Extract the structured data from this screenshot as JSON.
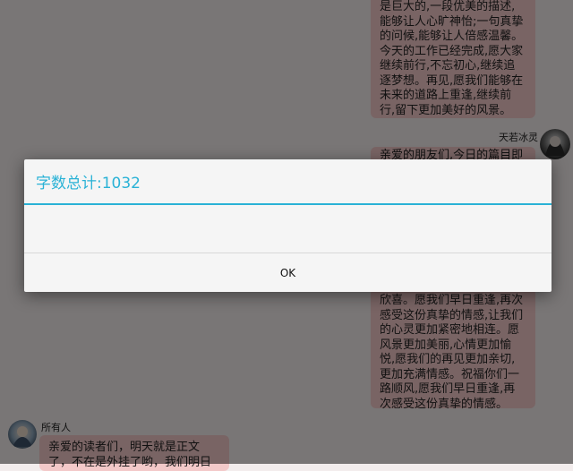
{
  "chat": {
    "top_message": "是巨大的,一段优美的描述,能够让人心旷神怡;一句真挚的问候,能够让人倍感温馨。今天的工作已经完成,愿大家继续前行,不忘初心,继续追逐梦想。再见,愿我们能够在未来的道路上重逢,继续前行,留下更加美好的风景。",
    "sender_right_name": "天若冰灵",
    "middle_partial": "亲爱的朋友们,今日的篇目即",
    "middle_message": "欣喜。愿我们早日重逢,再次感受这份真挚的情感,让我们的心灵更加紧密地相连。愿风景更加美丽,心情更加愉悦,愿我们的再见更加亲切,更加充满情感。祝福你们一路顺风,愿我们早日重逢,再次感受这份真挚的情感。",
    "sender_left_name": "所有人",
    "bottom_message": "亲爱的读者们，明天就是正文了，不在是外挂了哟，我们明日不"
  },
  "dialog": {
    "title": "字数总计:1032",
    "ok_label": "OK"
  },
  "colors": {
    "accent": "#2ab2d6",
    "bubble": "#f3c9c9",
    "overlay": "rgba(0,0,0,0.5)"
  }
}
